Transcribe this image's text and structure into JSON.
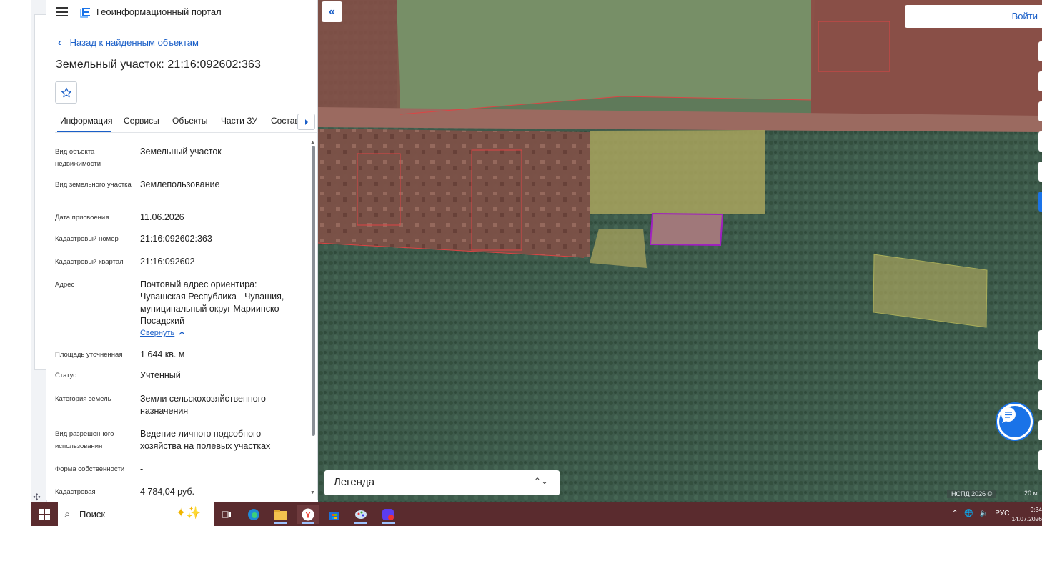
{
  "header": {
    "portal_title": "Геоинформационный портал"
  },
  "nav": {
    "back_label": "Назад к найденным объектам"
  },
  "object": {
    "title": "Земельный участок: 21:16:092602:363"
  },
  "tabs": [
    {
      "label": "Информация",
      "active": true
    },
    {
      "label": "Сервисы"
    },
    {
      "label": "Объекты"
    },
    {
      "label": "Части ЗУ"
    },
    {
      "label": "Состав"
    }
  ],
  "properties": [
    {
      "key": "Вид объекта недвижимости",
      "value": "Земельный участок"
    },
    {
      "key": "Вид земельного участка",
      "value": "Землепользование"
    },
    {
      "key": "Дата присвоения",
      "value": "11.06.2026"
    },
    {
      "key": "Кадастровый номер",
      "value": "21:16:092602:363"
    },
    {
      "key": "Кадастровый квартал",
      "value": "21:16:092602"
    },
    {
      "key": "Адрес",
      "value": "Почтовый адрес ориентира: Чувашская Республика - Чувашия, муниципальный округ Мариинско-Посадский",
      "link": "Свернуть"
    },
    {
      "key": "Площадь уточненная",
      "value": "1 644 кв. м"
    },
    {
      "key": "Статус",
      "value": "Учтенный"
    },
    {
      "key": "Категория земель",
      "value": "Земли сельскохозяйственного назначения"
    },
    {
      "key": "Вид разрешенного использования",
      "value": "Ведение личного подсобного хозяйства на полевых участках"
    },
    {
      "key": "Форма собственности",
      "value": "-"
    },
    {
      "key": "Кадастровая",
      "value": "4 784,04 руб."
    }
  ],
  "map": {
    "login_label": "Войти",
    "legend_label": "Легенда",
    "attribution": "НСПД 2026 ©",
    "scale": "20 м"
  },
  "taskbar": {
    "search_placeholder": "Поиск",
    "lang": "РУС",
    "time": "9:34",
    "date": "14.07.2026"
  },
  "colors": {
    "accent": "#1a5fc8",
    "taskbar": "#5a2b2e",
    "selected_parcel": "#a020c0"
  }
}
